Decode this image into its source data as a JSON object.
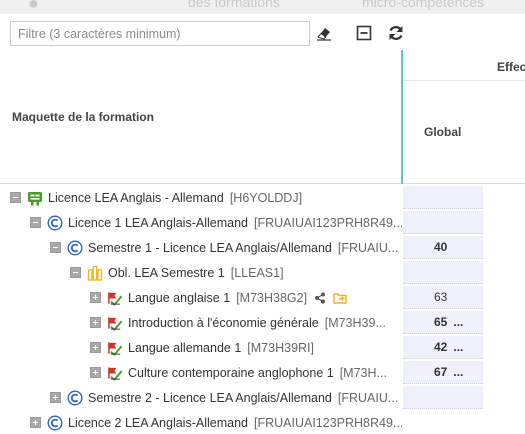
{
  "topbar": {
    "ghost1": "",
    "ghost2": "des formations",
    "ghost3": "micro-compétences"
  },
  "filter": {
    "placeholder": "Filtre (3 caractères minimum)",
    "value": ""
  },
  "header": {
    "tree_title": "Maquette de la formation",
    "effectifs_label": "Effec",
    "global_label": "Global"
  },
  "colors": {
    "accent_divider": "#5fc6d3",
    "cell_bg": "#eef1fa",
    "icon_blue": "#2e66b8",
    "icon_green": "#4a9a2f",
    "icon_orange": "#f0b21e",
    "icon_red": "#c8382c"
  },
  "tree": [
    {
      "label": "Licence LEA Anglais - Allemand",
      "code": "[H6YOLDDJ]",
      "icon": "diploma-icon",
      "expander": "minus",
      "level": 0,
      "value": "",
      "bold": false
    },
    {
      "label": "Licence 1 LEA Anglais-Allemand",
      "code": "[FRUAIUAI123PRH8R49...",
      "icon": "course-c-icon",
      "expander": "minus",
      "level": 1,
      "value": "",
      "bold": false
    },
    {
      "label": "Semestre 1 - Licence LEA Anglais/Allemand",
      "code": "[FRUAIU...",
      "icon": "course-c-icon",
      "expander": "minus",
      "level": 2,
      "value": "40",
      "bold": true
    },
    {
      "label": "Obl. LEA Semestre 1",
      "code": "[LLEAS1]",
      "icon": "list-bars-icon",
      "expander": "minus",
      "level": 3,
      "value": "",
      "bold": false
    },
    {
      "label": "Langue anglaise 1",
      "code": "[M73H38G2]",
      "icon": "module-flag-icon",
      "expander": "plus",
      "level": 4,
      "value": "63",
      "bold": false,
      "extras": [
        "share-icon",
        "folder-share-icon"
      ]
    },
    {
      "label": "Introduction à l'économie générale",
      "code": "[M73H39...",
      "icon": "module-flag-icon",
      "expander": "plus",
      "level": 4,
      "value": "65",
      "bold": true,
      "dots": "..."
    },
    {
      "label": "Langue allemande 1",
      "code": "[M73H39RI]",
      "icon": "module-flag-icon",
      "expander": "plus",
      "level": 4,
      "value": "42",
      "bold": true,
      "dots": "..."
    },
    {
      "label": "Culture contemporaine anglophone 1",
      "code": "[M73H...",
      "icon": "module-flag-icon",
      "expander": "plus",
      "level": 4,
      "value": "67",
      "bold": true,
      "dots": "..."
    },
    {
      "label": "Semestre 2 - Licence LEA Anglais/Allemand",
      "code": "[FRUAIU...",
      "icon": "course-c-icon",
      "expander": "plus",
      "level": 2,
      "value": "",
      "bold": false
    },
    {
      "label": "Licence 2 LEA Anglais-Allemand",
      "code": "[FRUAIUAI123PRH8R49...",
      "icon": "course-c-icon",
      "expander": "plus",
      "level": 1,
      "value": "",
      "bold": false
    }
  ]
}
